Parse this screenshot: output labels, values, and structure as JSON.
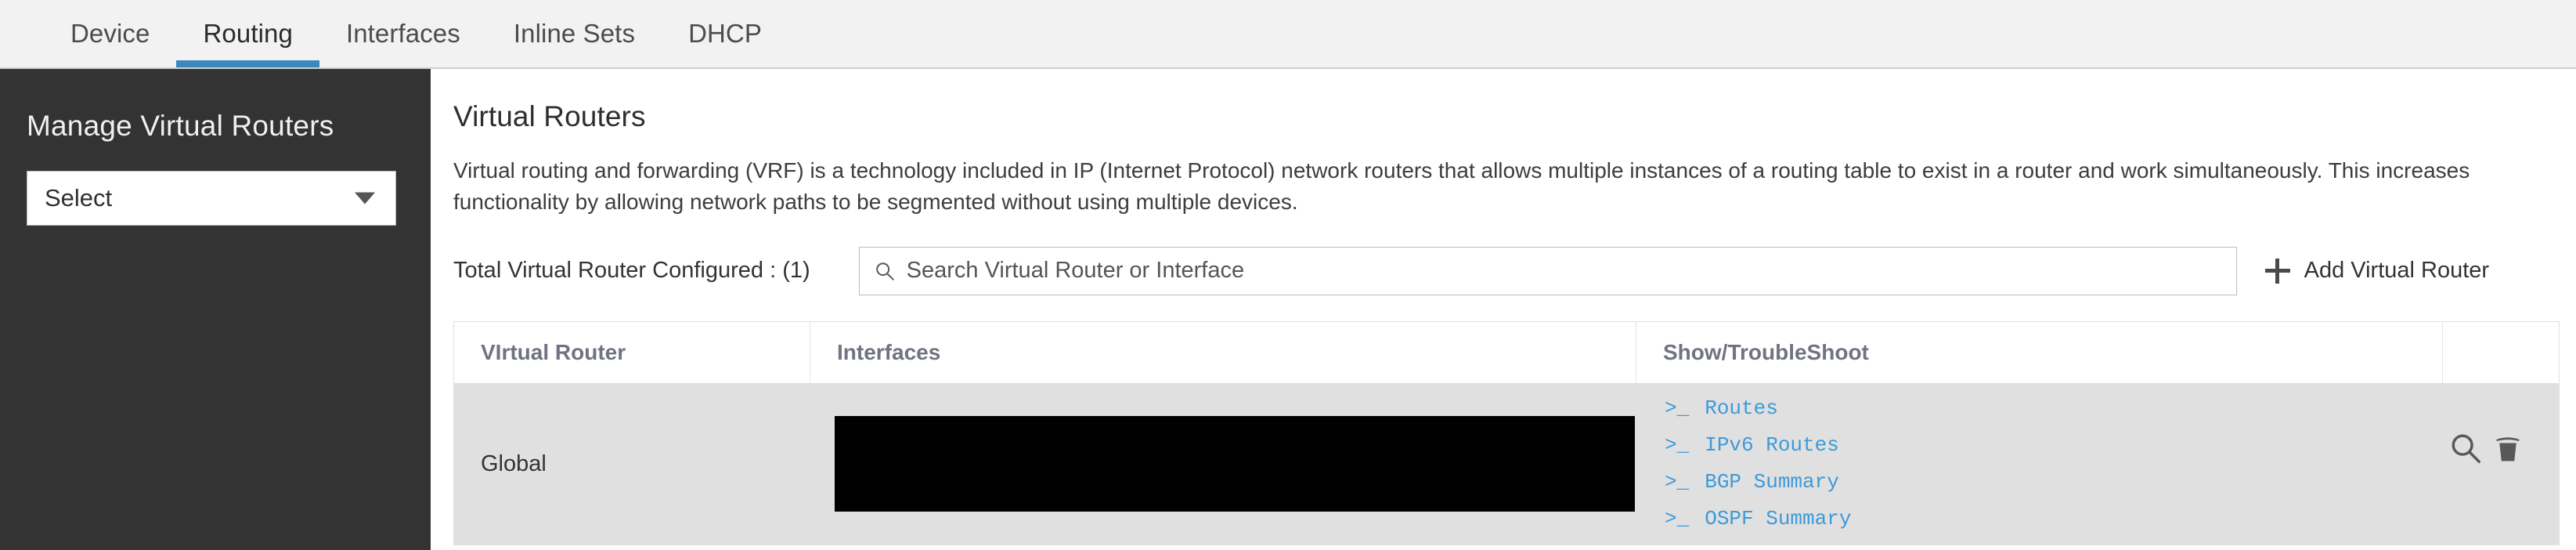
{
  "tabs": [
    {
      "label": "Device",
      "active": false
    },
    {
      "label": "Routing",
      "active": true
    },
    {
      "label": "Interfaces",
      "active": false
    },
    {
      "label": "Inline Sets",
      "active": false
    },
    {
      "label": "DHCP",
      "active": false
    }
  ],
  "sidebar": {
    "title": "Manage Virtual Routers",
    "select": {
      "value": "Select",
      "caret_icon": "chevron-down-icon"
    }
  },
  "main": {
    "title": "Virtual Routers",
    "description": "Virtual routing and forwarding (VRF) is a technology included in IP (Internet Protocol) network routers that allows multiple instances of a routing table to exist in a router and work simultaneously. This increases functionality by allowing network paths to be segmented without using multiple devices.",
    "toolbar": {
      "total_label": "Total Virtual Router Configured : (1)",
      "search_placeholder": "Search Virtual Router or Interface",
      "search_value": "",
      "search_icon": "search-icon",
      "add_label": "Add Virtual Router",
      "add_icon": "plus-icon"
    },
    "table": {
      "columns": [
        "VIrtual Router",
        "Interfaces",
        "Show/TroubleShoot",
        ""
      ],
      "rows": [
        {
          "virtual_router": "Global",
          "interfaces": "",
          "interfaces_redacted": true,
          "show_troubleshoot": [
            {
              "prompt": ">_",
              "label": "Routes"
            },
            {
              "prompt": ">_",
              "label": "IPv6 Routes"
            },
            {
              "prompt": ">_",
              "label": "BGP Summary"
            },
            {
              "prompt": ">_",
              "label": "OSPF Summary"
            }
          ],
          "actions": [
            {
              "name": "view-icon",
              "title": "View"
            },
            {
              "name": "delete-icon",
              "title": "Delete"
            }
          ]
        }
      ]
    }
  },
  "colors": {
    "accent": "#3b88bb",
    "link": "#3d9ad9",
    "sidebar_bg": "#333333",
    "tabbar_bg": "#f3f2f3",
    "row_bg": "#e0e0e0",
    "header_text": "#6f7480"
  }
}
